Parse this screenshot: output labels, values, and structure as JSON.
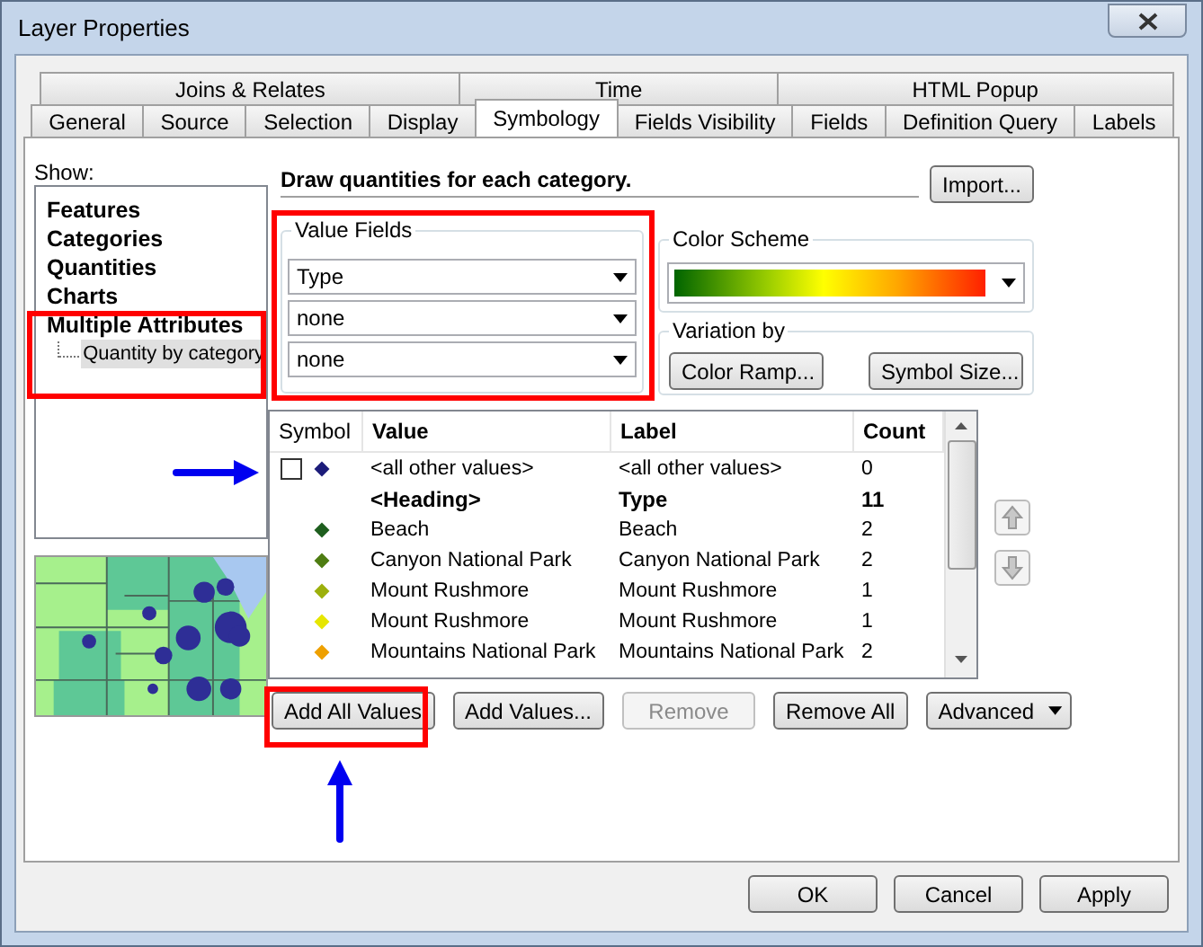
{
  "window": {
    "title": "Layer Properties"
  },
  "tabs": {
    "top_row": [
      {
        "label": "Joins & Relates",
        "selected": false
      },
      {
        "label": "Time",
        "selected": false
      },
      {
        "label": "HTML Popup",
        "selected": false
      }
    ],
    "bottom_row": [
      {
        "label": "General",
        "selected": false
      },
      {
        "label": "Source",
        "selected": false
      },
      {
        "label": "Selection",
        "selected": false
      },
      {
        "label": "Display",
        "selected": false
      },
      {
        "label": "Symbology",
        "selected": true
      },
      {
        "label": "Fields Visibility",
        "selected": false
      },
      {
        "label": "Fields",
        "selected": false
      },
      {
        "label": "Definition Query",
        "selected": false
      },
      {
        "label": "Labels",
        "selected": false
      }
    ]
  },
  "show": {
    "label": "Show:",
    "items": [
      {
        "label": "Features",
        "selected": false
      },
      {
        "label": "Categories",
        "selected": false
      },
      {
        "label": "Quantities",
        "selected": false
      },
      {
        "label": "Charts",
        "selected": false
      },
      {
        "label": "Multiple Attributes",
        "selected": false,
        "children": [
          {
            "label": "Quantity by category",
            "selected": true
          }
        ]
      }
    ]
  },
  "description": "Draw quantities for each category.",
  "import_button": "Import...",
  "value_fields": {
    "title": "Value Fields",
    "fields": [
      "Type",
      "none",
      "none"
    ]
  },
  "color_scheme": {
    "title": "Color Scheme"
  },
  "variation": {
    "title": "Variation by",
    "buttons": [
      "Color Ramp...",
      "Symbol Size..."
    ]
  },
  "table": {
    "columns": [
      "Symbol",
      "Value",
      "Label",
      "Count"
    ],
    "rows": [
      {
        "kind": "default",
        "checked": false,
        "color": "#1c1c7a",
        "value": "<all other values>",
        "label": "<all other values>",
        "count": "0"
      },
      {
        "kind": "heading",
        "value": "<Heading>",
        "label": "Type",
        "count": "11"
      },
      {
        "kind": "value",
        "color": "#1e5e1e",
        "value": "Beach",
        "label": "Beach",
        "count": "2"
      },
      {
        "kind": "value",
        "color": "#4e7d12",
        "value": "Canyon National Park",
        "label": "Canyon National Park",
        "count": "2"
      },
      {
        "kind": "value",
        "color": "#9cb00c",
        "value": "Mount Rushmore",
        "label": "Mount Rushmore",
        "count": "1"
      },
      {
        "kind": "value",
        "color": "#e6e600",
        "value": "Mount Rushmore",
        "label": "Mount Rushmore",
        "count": "1"
      },
      {
        "kind": "value",
        "color": "#eea000",
        "value": "Mountains National Park",
        "label": "Mountains National Park",
        "count": "2"
      }
    ]
  },
  "actions": [
    {
      "kind": "button",
      "label": "Add All Values",
      "disabled": false
    },
    {
      "kind": "button",
      "label": "Add Values...",
      "disabled": false
    },
    {
      "kind": "button",
      "label": "Remove",
      "disabled": true
    },
    {
      "kind": "button",
      "label": "Remove All",
      "disabled": false
    },
    {
      "kind": "menu",
      "label": "Advanced",
      "disabled": false
    }
  ],
  "footer": [
    "OK",
    "Cancel",
    "Apply"
  ]
}
